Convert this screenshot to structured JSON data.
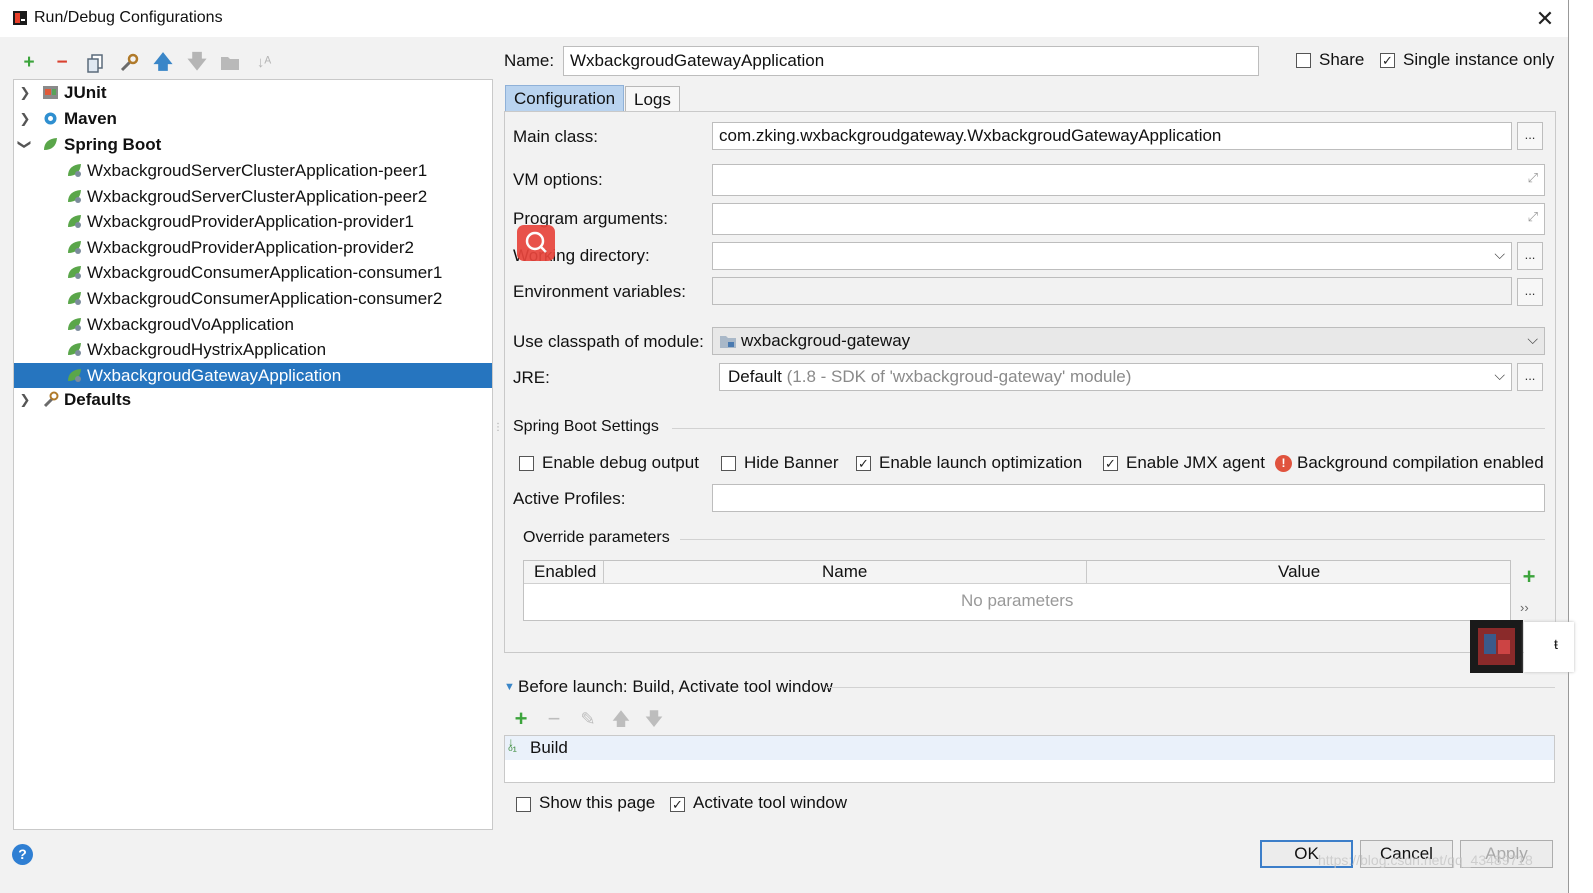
{
  "window": {
    "title": "Run/Debug Configurations"
  },
  "toolbar": {
    "icons": [
      "add-icon",
      "remove-icon",
      "copy-icon",
      "wrench-icon",
      "move-up-icon",
      "move-down-icon",
      "folder-icon",
      "sort-icon"
    ]
  },
  "tree": {
    "groups": [
      {
        "label": "JUnit"
      },
      {
        "label": "Maven"
      },
      {
        "label": "Spring Boot"
      },
      {
        "label": "Defaults"
      }
    ],
    "spring_items": [
      "WxbackgroudServerClusterApplication-peer1",
      "WxbackgroudServerClusterApplication-peer2",
      "WxbackgroudProviderApplication-provider1",
      "WxbackgroudProviderApplication-provider2",
      "WxbackgroudConsumerApplication-consumer1",
      "WxbackgroudConsumerApplication-consumer2",
      "WxbackgroudVoApplication",
      "WxbackgroudHystrixApplication",
      "WxbackgroudGatewayApplication"
    ]
  },
  "header": {
    "name_label": "Name:",
    "name_value": "WxbackgroudGatewayApplication",
    "share_label": "Share",
    "single_instance_label": "Single instance only"
  },
  "tabs": {
    "configuration": "Configuration",
    "logs": "Logs"
  },
  "form": {
    "main_class_label": "Main class:",
    "main_class_value": "com.zking.wxbackgroudgateway.WxbackgroudGatewayApplication",
    "vm_options_label": "VM options:",
    "program_args_label": "Program arguments:",
    "working_dir_label": "Working directory:",
    "env_vars_label": "Environment variables:",
    "classpath_label": "Use classpath of module:",
    "classpath_value": "wxbackgroud-gateway",
    "jre_label": "JRE:",
    "jre_value": "Default",
    "jre_detail": "(1.8 - SDK of 'wxbackgroud-gateway' module)",
    "dots": "..."
  },
  "spring_settings": {
    "title": "Spring Boot Settings",
    "debug_output": "Enable debug output",
    "hide_banner": "Hide Banner",
    "launch_opt": "Enable launch optimization",
    "jmx_agent": "Enable JMX agent",
    "bg_compilation": "Background compilation enabled",
    "active_profiles_label": "Active Profiles:"
  },
  "override": {
    "title": "Override parameters",
    "columns": [
      "Enabled",
      "Name",
      "Value"
    ],
    "empty": "No parameters"
  },
  "before_launch": {
    "title": "Before launch: Build, Activate tool window",
    "item": "Build",
    "show_page": "Show this page",
    "activate_tool": "Activate tool window"
  },
  "buttons": {
    "ok": "OK",
    "cancel": "Cancel",
    "apply": "Apply"
  },
  "watermark": "https://blog.csdn.net/qq_43489718"
}
